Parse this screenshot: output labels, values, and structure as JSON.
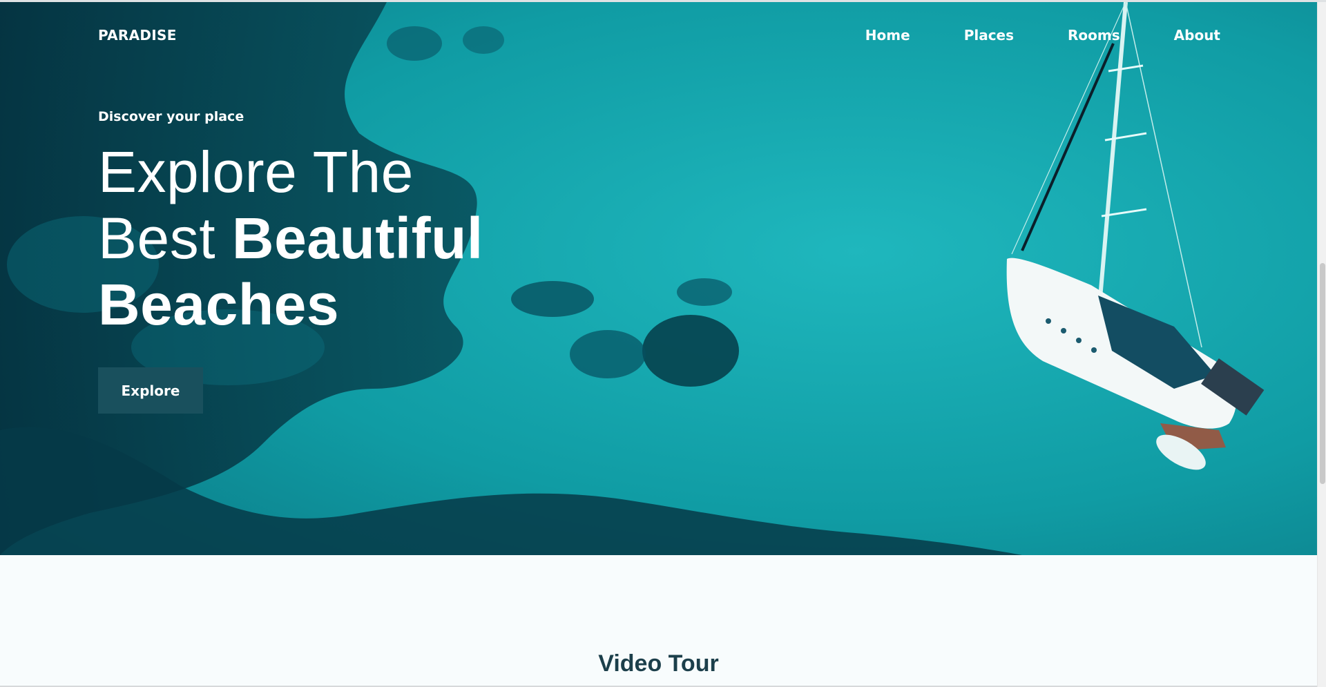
{
  "brand": "PARADISE",
  "nav": {
    "items": [
      {
        "label": "Home"
      },
      {
        "label": "Places"
      },
      {
        "label": "Rooms"
      },
      {
        "label": "About"
      }
    ]
  },
  "hero": {
    "kicker": "Discover your place",
    "headline": {
      "line1": "Explore The",
      "line2_light": "Best ",
      "line2_bold": "Beautiful",
      "line3": "Beaches"
    },
    "cta_label": "Explore"
  },
  "section": {
    "title": "Video Tour"
  },
  "colors": {
    "sea": "#0f8d96",
    "deep_water": "#063a48",
    "button_bg": "#19505d",
    "title_text": "#1c3f4b",
    "lower_bg": "#f8fcfd"
  }
}
